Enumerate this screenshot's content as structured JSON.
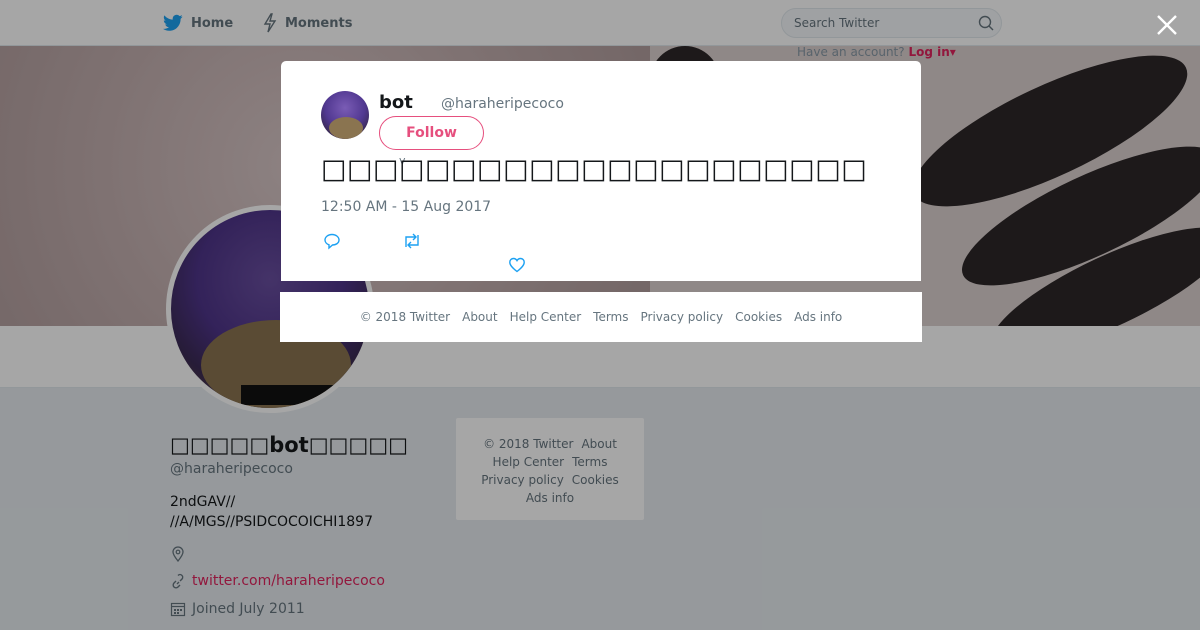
{
  "nav": {
    "home_label": "Home",
    "moments_label": "Moments",
    "search_placeholder": "Search Twitter",
    "account_prompt": "Have an account?",
    "login_label": "Log in"
  },
  "profile": {
    "name": "□□□□□bot□□□□□",
    "handle": "@haraheripecoco",
    "bio_line1": "2ndGAV//",
    "bio_line2": "//A/MGS//PSIDCOCOICHI1897",
    "url": "twitter.com/haraheripecoco",
    "joined": "Joined July 2011"
  },
  "side_footer": {
    "copyright": "© 2018 Twitter",
    "about": "About",
    "help": "Help Center",
    "terms": "Terms",
    "privacy": "Privacy policy",
    "cookies": "Cookies",
    "ads": "Ads info"
  },
  "tweet": {
    "name": "bot",
    "handle": "@haraheripecoco",
    "follow_label": "Follow",
    "caret": "v",
    "text": "□□□□□□□□□□□□□□□□□□□□□",
    "time": "12:50 AM - 15 Aug 2017"
  },
  "modal_footer": {
    "copyright": "© 2018 Twitter",
    "about": "About",
    "help": "Help Center",
    "terms": "Terms",
    "privacy": "Privacy policy",
    "cookies": "Cookies",
    "ads": "Ads info"
  },
  "colors": {
    "accent": "#e0245e",
    "twitter_blue": "#1da1f2"
  }
}
